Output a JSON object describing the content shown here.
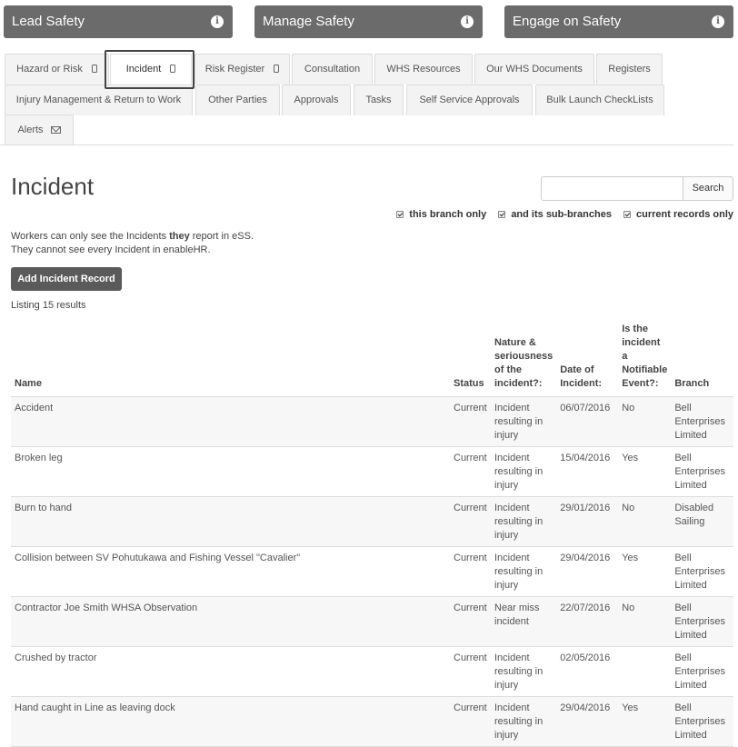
{
  "top_cards": [
    {
      "label": "Lead Safety"
    },
    {
      "label": "Manage Safety"
    },
    {
      "label": "Engage on Safety"
    }
  ],
  "tabs": {
    "hazard": "Hazard or Risk",
    "incident": "Incident",
    "risk_register": "Risk Register",
    "consultation": "Consultation",
    "whs_resources": "WHS Resources",
    "our_whs_documents": "Our WHS Documents",
    "registers": "Registers",
    "injury_management": "Injury Management & Return to Work",
    "other_parties": "Other Parties",
    "approvals": "Approvals",
    "tasks": "Tasks",
    "self_service_approvals": "Self Service Approvals",
    "bulk_launch": "Bulk Launch CheckLists",
    "alerts": "Alerts"
  },
  "page": {
    "title": "Incident",
    "search_button": "Search",
    "filters": [
      "this branch only",
      "and its sub-branches",
      "current records only"
    ],
    "note_line1_pre": "Workers can only see the Incidents ",
    "note_line1_bold": "they",
    "note_line1_post": " report in eSS.",
    "note_line2": "They cannot see every Incident in enableHR.",
    "add_button": "Add Incident Record",
    "listing": "Listing 15 results"
  },
  "table": {
    "headers": {
      "name": "Name",
      "status": "Status",
      "nature": "Nature & seriousness of the incident?:",
      "date": "Date of Incident:",
      "notifiable": "Is the incident a Notifiable Event?:",
      "branch": "Branch"
    },
    "rows": [
      {
        "name": "Accident",
        "status": "Current",
        "nature": "Incident resulting in injury",
        "date": "06/07/2016",
        "notifiable": "No",
        "branch": "Bell Enterprises Limited"
      },
      {
        "name": "Broken leg",
        "status": "Current",
        "nature": "Incident resulting in injury",
        "date": "15/04/2016",
        "notifiable": "Yes",
        "branch": "Bell Enterprises Limited"
      },
      {
        "name": "Burn to hand",
        "status": "Current",
        "nature": "Incident resulting in injury",
        "date": "29/01/2016",
        "notifiable": "No",
        "branch": "Disabled Sailing"
      },
      {
        "name": "Collision between SV Pohutukawa and Fishing Vessel \"Cavalier\"",
        "status": "Current",
        "nature": "Incident resulting in injury",
        "date": "29/04/2016",
        "notifiable": "Yes",
        "branch": "Bell Enterprises Limited"
      },
      {
        "name": "Contractor Joe Smith WHSA Observation",
        "status": "Current",
        "nature": "Near miss incident",
        "date": "22/07/2016",
        "notifiable": "No",
        "branch": "Bell Enterprises Limited"
      },
      {
        "name": "Crushed by tractor",
        "status": "Current",
        "nature": "Incident resulting in injury",
        "date": "02/05/2016",
        "notifiable": "",
        "branch": "Bell Enterprises Limited"
      },
      {
        "name": "Hand caught in Line as leaving dock",
        "status": "Current",
        "nature": "Incident resulting in injury",
        "date": "29/04/2016",
        "notifiable": "Yes",
        "branch": "Bell Enterprises Limited"
      }
    ]
  }
}
